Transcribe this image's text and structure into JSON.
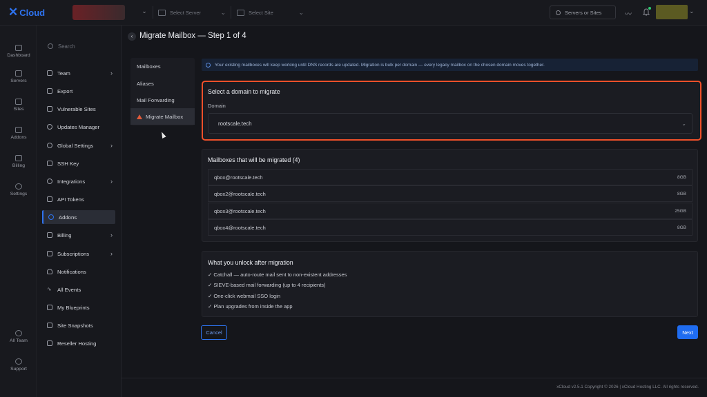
{
  "app": {
    "logo_text": "Cloud"
  },
  "topbar": {
    "server_placeholder": "Select Server",
    "site_placeholder": "Select Site",
    "search_label": "Servers or Sites"
  },
  "rail": {
    "items": [
      {
        "label": "Dashboard",
        "icon": "dashboard-icon"
      },
      {
        "label": "Servers",
        "icon": "servers-icon"
      },
      {
        "label": "Sites",
        "icon": "sites-icon"
      },
      {
        "label": "Addons",
        "icon": "addons-icon"
      },
      {
        "label": "Billing",
        "icon": "billing-icon"
      },
      {
        "label": "Settings",
        "icon": "settings-icon"
      },
      {
        "label": "All Team",
        "icon": "team-icon"
      },
      {
        "label": "Support",
        "icon": "support-icon"
      }
    ]
  },
  "sidebar": {
    "search_placeholder": "Search",
    "items": [
      {
        "label": "Team",
        "arrow": "›"
      },
      {
        "label": "Export"
      },
      {
        "label": "Vulnerable Sites"
      },
      {
        "label": "Updates Manager"
      },
      {
        "label": "Global Settings",
        "arrow": "›"
      },
      {
        "label": "SSH Key"
      },
      {
        "label": "Integrations",
        "arrow": "›"
      },
      {
        "label": "API Tokens"
      },
      {
        "label": "Addons",
        "active": true
      },
      {
        "label": "Billing",
        "arrow": "›"
      },
      {
        "label": "Subscriptions",
        "arrow": "›"
      },
      {
        "label": "Notifications"
      },
      {
        "label": "All Events"
      },
      {
        "label": "My Blueprints"
      },
      {
        "label": "Site Snapshots"
      },
      {
        "label": "Reseller Hosting"
      }
    ]
  },
  "header": {
    "title": "Migrate Mailbox — Step 1 of 4"
  },
  "tabs": [
    {
      "label": "Mailboxes"
    },
    {
      "label": "Aliases"
    },
    {
      "label": "Mail Forwarding"
    },
    {
      "label": "Migrate Mailbox",
      "active": true
    }
  ],
  "info_banner": "Your existing mailboxes will keep working until DNS records are updated. Migration is bulk per domain — every legacy mailbox on the chosen domain moves together.",
  "domain_panel": {
    "heading": "Select a domain to migrate",
    "label": "Domain",
    "selected": "rootscale.tech"
  },
  "mailboxes_panel": {
    "heading": "Mailboxes that will be migrated (4)",
    "rows": [
      {
        "email": "qbox@rootscale.tech",
        "size": "8GB"
      },
      {
        "email": "qbox2@rootscale.tech",
        "size": "8GB"
      },
      {
        "email": "qbox3@rootscale.tech",
        "size": "25GB"
      },
      {
        "email": "qbox4@rootscale.tech",
        "size": "8GB"
      }
    ]
  },
  "unlock_panel": {
    "heading": "What you unlock after migration",
    "items": [
      "✓ Catchall — auto-route mail sent to non-existent addresses",
      "✓ SIEVE-based mail forwarding (up to 4 recipients)",
      "✓ One-click webmail SSO login",
      "✓ Plan upgrades from inside the app"
    ]
  },
  "actions": {
    "cancel": "Cancel",
    "next": "Next"
  },
  "footer": {
    "copyright": "xCloud v2.5.1 Copyright © 2026 | xCloud Hosting LLC. All rights reserved."
  },
  "colors": {
    "accent": "#2e73f0",
    "highlight_border": "#f0502a",
    "background": "#15161b"
  }
}
